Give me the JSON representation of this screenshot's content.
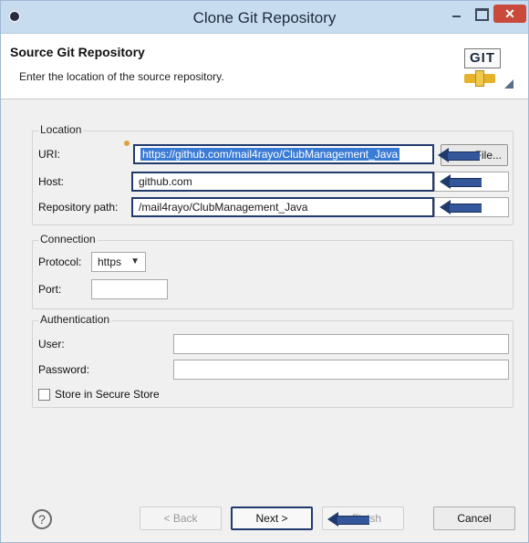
{
  "window": {
    "title": "Clone Git Repository"
  },
  "header": {
    "title": "Source Git Repository",
    "description": "Enter the location of the source repository.",
    "logo_text": "GIT"
  },
  "location": {
    "group_label": "Location",
    "uri_label": "URI:",
    "uri_value": "https://github.com/mail4rayo/ClubManagement_Java",
    "file_button": "File...",
    "host_label": "Host:",
    "host_value": "github.com",
    "repo_label": "Repository path:",
    "repo_value": "/mail4rayo/ClubManagement_Java"
  },
  "connection": {
    "group_label": "Connection",
    "protocol_label": "Protocol:",
    "protocol_value": "https",
    "port_label": "Port:",
    "port_value": ""
  },
  "authentication": {
    "group_label": "Authentication",
    "user_label": "User:",
    "user_value": "",
    "password_label": "Password:",
    "password_value": "",
    "store_label": "Store in Secure Store",
    "store_checked": false
  },
  "footer": {
    "help_glyph": "?",
    "back_label": "< Back",
    "next_label": "Next >",
    "finish_label": "Finish",
    "cancel_label": "Cancel"
  },
  "colors": {
    "annotation_arrow": "#34579b",
    "selection": "#3a7bd5",
    "close_button": "#c94a3a"
  },
  "icons": [
    "app-icon",
    "minimize-icon",
    "maximize-icon",
    "close-icon",
    "git-logo",
    "help-icon",
    "arrow-annotation"
  ]
}
